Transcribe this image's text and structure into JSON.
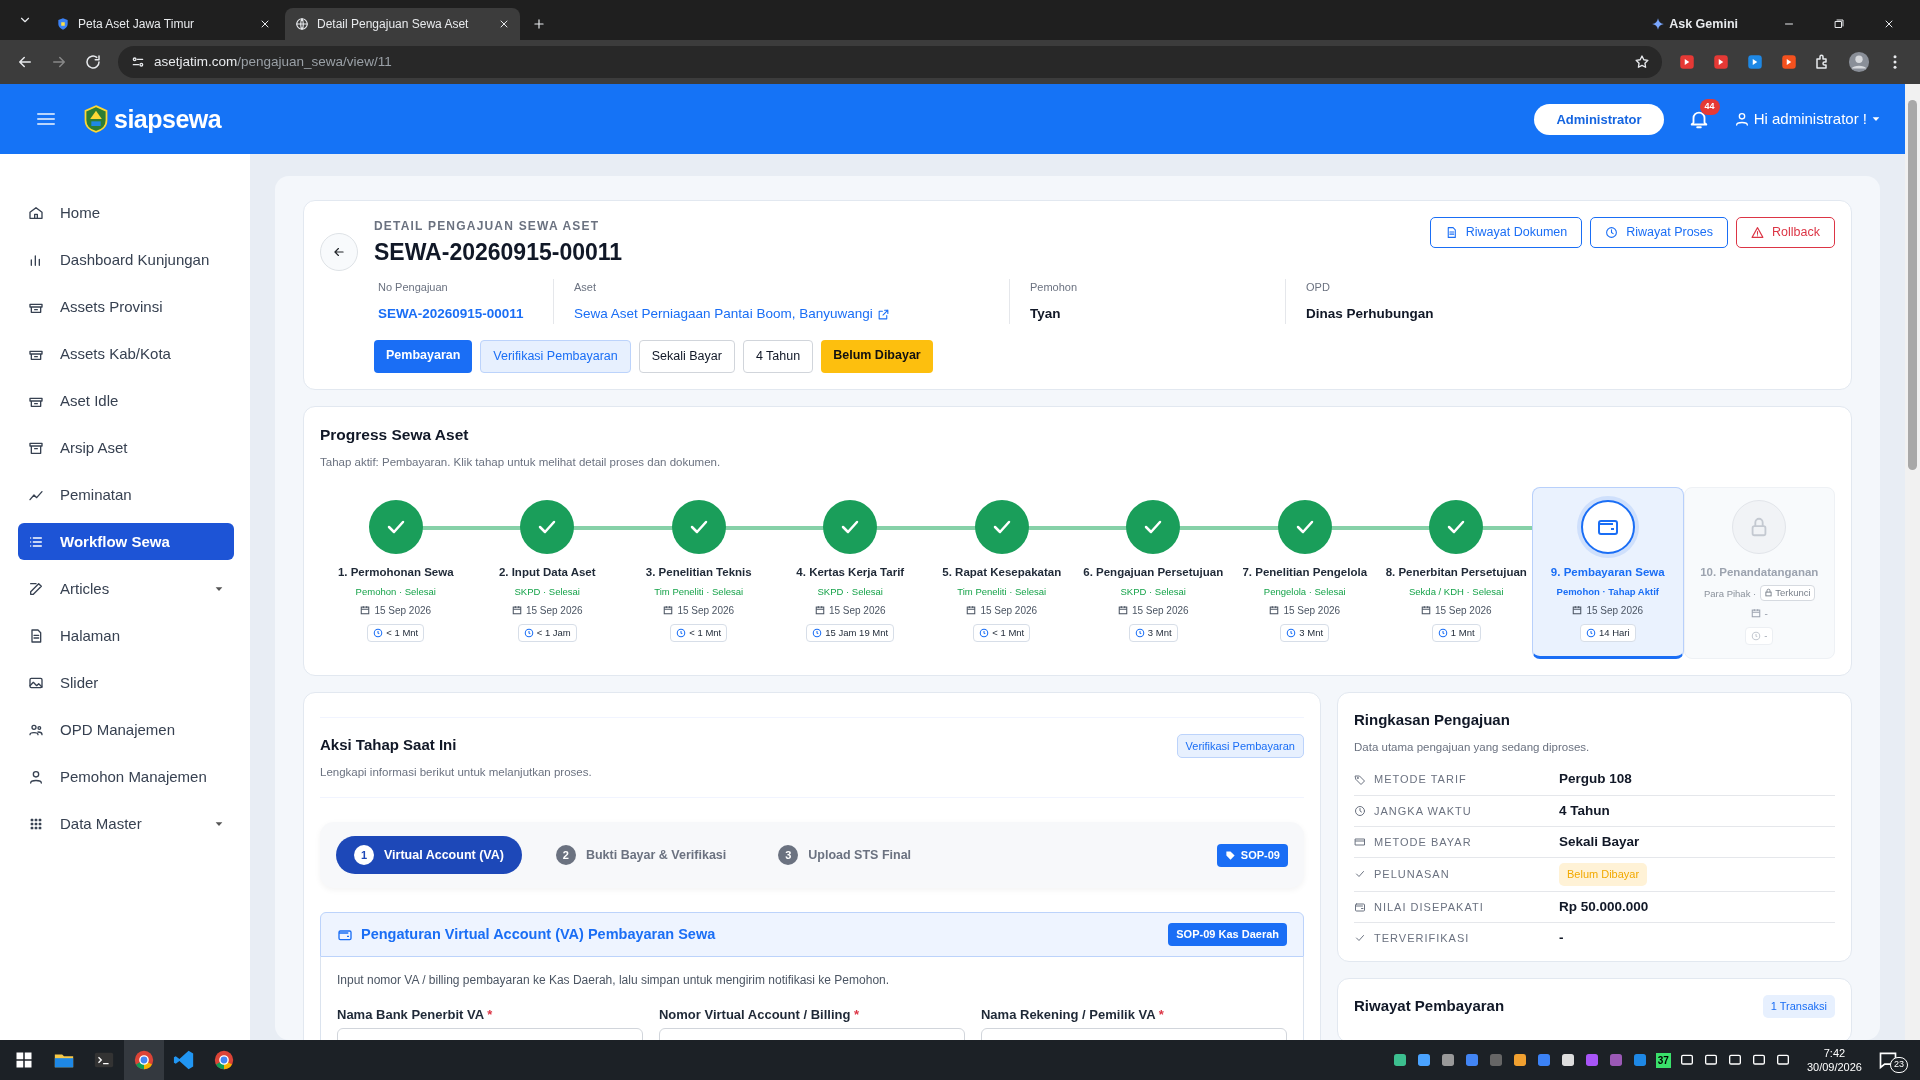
{
  "browser": {
    "tabs": [
      {
        "title": "Peta Aset Jawa Timur",
        "selected": false
      },
      {
        "title": "Detail Pengajuan Sewa Aset",
        "selected": true
      }
    ],
    "gemini": "Ask Gemini",
    "url_host": "asetjatim.com",
    "url_path": "/pengajuan_sewa/view/11"
  },
  "header": {
    "brand": "siapsewa",
    "role": "Administrator",
    "notifications": "44",
    "user": "Hi administrator !"
  },
  "sidebar": {
    "items": [
      {
        "label": "Home",
        "selected": false,
        "expandable": false
      },
      {
        "label": "Dashboard Kunjungan",
        "selected": false,
        "expandable": false
      },
      {
        "label": "Assets Provinsi",
        "selected": false,
        "expandable": false
      },
      {
        "label": "Assets Kab/Kota",
        "selected": false,
        "expandable": false
      },
      {
        "label": "Aset Idle",
        "selected": false,
        "expandable": false
      },
      {
        "label": "Arsip Aset",
        "selected": false,
        "expandable": false
      },
      {
        "label": "Peminatan",
        "selected": false,
        "expandable": false
      },
      {
        "label": "Workflow Sewa",
        "selected": true,
        "expandable": false
      },
      {
        "label": "Articles",
        "selected": false,
        "expandable": true
      },
      {
        "label": "Halaman",
        "selected": false,
        "expandable": false
      },
      {
        "label": "Slider",
        "selected": false,
        "expandable": false
      },
      {
        "label": "OPD Manajemen",
        "selected": false,
        "expandable": false
      },
      {
        "label": "Pemohon Manajemen",
        "selected": false,
        "expandable": false
      },
      {
        "label": "Data Master",
        "selected": false,
        "expandable": true
      }
    ]
  },
  "detail": {
    "overline": "DETAIL PENGAJUAN SEWA ASET",
    "code": "SEWA-20260915-00011",
    "actions": [
      {
        "label": "Riwayat Dokumen",
        "kind": "primary"
      },
      {
        "label": "Riwayat Proses",
        "kind": "primary"
      },
      {
        "label": "Rollback",
        "kind": "danger"
      }
    ],
    "fields": [
      {
        "label": "No Pengajuan",
        "value": "SEWA-20260915-00011",
        "kind": "link"
      },
      {
        "label": "Aset",
        "value": "Sewa Aset Perniagaan Pantai Boom, Banyuwangi",
        "kind": "external"
      },
      {
        "label": "Pemohon",
        "value": "Tyan",
        "kind": "text"
      },
      {
        "label": "OPD",
        "value": "Dinas Perhubungan",
        "kind": "text"
      }
    ],
    "tags": [
      {
        "label": "Pembayaran",
        "kind": "primary"
      },
      {
        "label": "Verifikasi Pembayaran",
        "kind": "soft"
      },
      {
        "label": "Sekali Bayar",
        "kind": "outline"
      },
      {
        "label": "4 Tahun",
        "kind": "outline"
      },
      {
        "label": "Belum Dibayar",
        "kind": "warning"
      }
    ]
  },
  "progress": {
    "title": "Progress Sewa Aset",
    "subtitle": "Tahap aktif: Pembayaran. Klik tahap untuk melihat detail proses dan dokumen.",
    "steps": [
      {
        "title": "1. Permohonan Sewa",
        "caption": "Pemohon · Selesai",
        "date": "15 Sep 2026",
        "duration": "< 1 Mnt",
        "completed": true,
        "current": false,
        "locked": false
      },
      {
        "title": "2. Input Data Aset",
        "caption": "SKPD · Selesai",
        "date": "15 Sep 2026",
        "duration": "< 1 Jam",
        "completed": true,
        "current": false,
        "locked": false
      },
      {
        "title": "3. Penelitian Teknis",
        "caption": "Tim Peneliti · Selesai",
        "date": "15 Sep 2026",
        "duration": "< 1 Mnt",
        "completed": true,
        "current": false,
        "locked": false
      },
      {
        "title": "4. Kertas Kerja Tarif",
        "caption": "SKPD · Selesai",
        "date": "15 Sep 2026",
        "duration": "15 Jam 19 Mnt",
        "completed": true,
        "current": false,
        "locked": false
      },
      {
        "title": "5. Rapat Kesepakatan",
        "caption": "Tim Peneliti · Selesai",
        "date": "15 Sep 2026",
        "duration": "< 1 Mnt",
        "completed": true,
        "current": false,
        "locked": false
      },
      {
        "title": "6. Pengajuan Persetujuan",
        "caption": "SKPD · Selesai",
        "date": "15 Sep 2026",
        "duration": "3 Mnt",
        "completed": true,
        "current": false,
        "locked": false
      },
      {
        "title": "7. Penelitian Pengelola",
        "caption": "Pengelola · Selesai",
        "date": "15 Sep 2026",
        "duration": "3 Mnt",
        "completed": true,
        "current": false,
        "locked": false
      },
      {
        "title": "8. Penerbitan Persetujuan",
        "caption": "Sekda / KDH · Selesai",
        "date": "15 Sep 2026",
        "duration": "1 Mnt",
        "completed": true,
        "current": false,
        "locked": false
      },
      {
        "title": "9. Pembayaran Sewa",
        "caption": "Pemohon · Tahap Aktif",
        "date": "15 Sep 2026",
        "duration": "14 Hari",
        "completed": false,
        "current": true,
        "locked": false
      },
      {
        "title": "10. Penandatanganan",
        "caption": "Para Pihak ·",
        "lock_label": "Terkunci",
        "date": "-",
        "duration": "-",
        "completed": false,
        "current": false,
        "locked": true
      }
    ]
  },
  "action": {
    "title": "Aksi Tahap Saat Ini",
    "subtitle": "Lengkapi informasi berikut untuk melanjutkan proses.",
    "badge": "Verifikasi Pembayaran",
    "substeps": [
      {
        "number": "1",
        "label": "Virtual Account (VA)",
        "selected": true
      },
      {
        "number": "2",
        "label": "Bukti Bayar & Verifikasi",
        "selected": false
      },
      {
        "number": "3",
        "label": "Upload STS Final",
        "selected": false
      }
    ],
    "sop": "SOP-09",
    "panel": {
      "title": "Pengaturan Virtual Account (VA) Pembayaran Sewa",
      "badge": "SOP-09 Kas Daerah",
      "description": "Input nomor VA / billing pembayaran ke Kas Daerah, lalu simpan untuk mengirim notifikasi ke Pemohon.",
      "fields": [
        {
          "label": "Nama Bank Penerbit VA",
          "required_mark": "*"
        },
        {
          "label": "Nomor Virtual Account / Billing",
          "required_mark": "*"
        },
        {
          "label": "Nama Rekening / Pemilik VA",
          "required_mark": "*"
        }
      ]
    }
  },
  "summary": {
    "title": "Ringkasan Pengajuan",
    "subtitle": "Data utama pengajuan yang sedang diproses.",
    "rows": [
      {
        "label": "METODE TARIF",
        "value": "Pergub 108",
        "kind": "text"
      },
      {
        "label": "JANGKA WAKTU",
        "value": "4 Tahun",
        "kind": "text"
      },
      {
        "label": "METODE BAYAR",
        "value": "Sekali Bayar",
        "kind": "text"
      },
      {
        "label": "PELUNASAN",
        "value": "Belum Dibayar",
        "kind": "badge"
      },
      {
        "label": "NILAI DISEPAKATI",
        "value": "Rp 50.000.000",
        "kind": "text"
      },
      {
        "label": "TERVERIFIKASI",
        "value": "-",
        "kind": "text"
      }
    ]
  },
  "history": {
    "title": "Riwayat Pembayaran",
    "badge": "1 Transaksi"
  },
  "taskbar": {
    "tray_number": "37",
    "time": "7:42",
    "date": "30/09/2026",
    "notifications": "23"
  }
}
